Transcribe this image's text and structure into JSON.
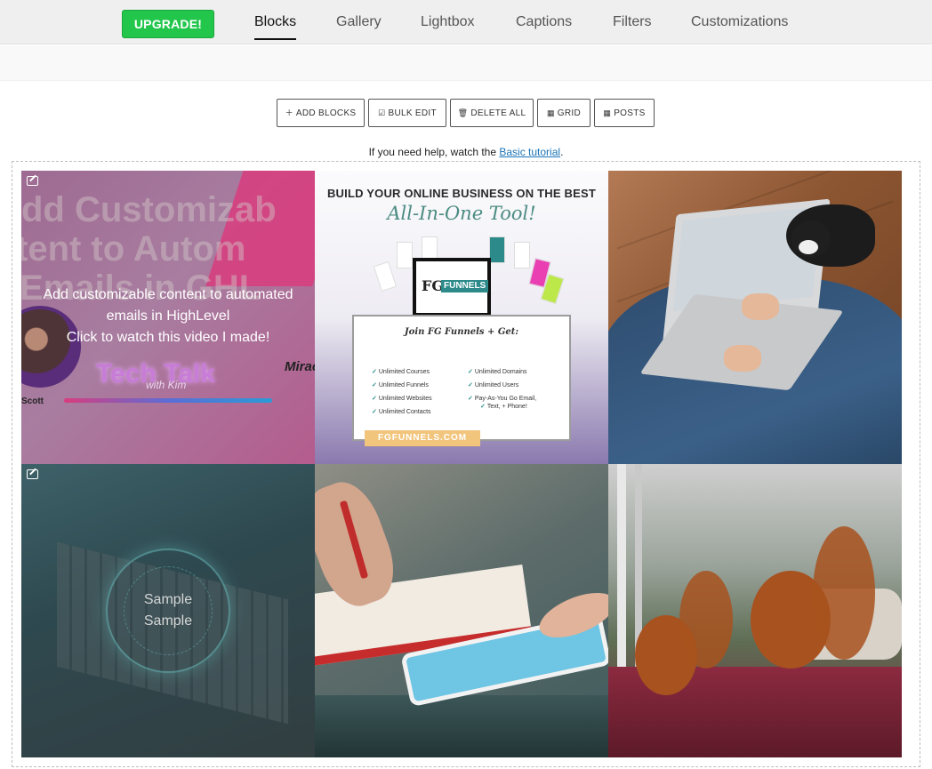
{
  "nav": {
    "upgrade_label": "UPGRADE!",
    "tabs": [
      {
        "label": "Blocks",
        "active": true
      },
      {
        "label": "Gallery",
        "active": false
      },
      {
        "label": "Lightbox",
        "active": false
      },
      {
        "label": "Captions",
        "active": false
      },
      {
        "label": "Filters",
        "active": false
      },
      {
        "label": "Customizations",
        "active": false
      }
    ]
  },
  "toolbar": {
    "add_blocks": {
      "icon": "plus-icon",
      "label": "ADD BLOCKS"
    },
    "bulk_edit": {
      "icon": "check-square-icon",
      "label": "BULK EDIT"
    },
    "delete_all": {
      "icon": "trash-icon",
      "label": "DELETE ALL"
    },
    "grid": {
      "icon": "grid-icon",
      "label": "GRID"
    },
    "posts": {
      "icon": "grid-icon",
      "label": "POSTS"
    }
  },
  "help": {
    "prefix": "If you need help, watch the ",
    "link_text": "Basic tutorial",
    "suffix": "."
  },
  "tiles": {
    "tile1": {
      "caption_line1": "Add customizable content to automated",
      "caption_line2": "emails in HighLevel",
      "caption_line3": "Click to watch this video I made!",
      "bg_line1": "dd Customizab",
      "bg_line2": "tent to Autom",
      "bg_line3": "Emails in GHL",
      "tech_talk": "Tech Talk",
      "with_kim": "with Kim",
      "name": "Scott",
      "script_name": "Mirac"
    },
    "tile2": {
      "headline": "BUILD YOUR ONLINE BUSINESS ON THE BEST",
      "subhead": "All-In-One Tool!",
      "logo_fg": "FG",
      "logo_funnels": "FUNNELS",
      "join": "Join FG Funnels + Get:",
      "features_left": [
        "Unlimited Courses",
        "Unlimited Funnels",
        "Unlimited Websites",
        "Unlimited Contacts"
      ],
      "features_right": [
        "Unlimited Domains",
        "Unlimited Users",
        "Pay-As-You Go Email,",
        "Text, + Phone!"
      ],
      "cta": "FGFUNNELS.COM"
    },
    "tile4": {
      "caption_line1": "Sample",
      "caption_line2": "Sample"
    }
  }
}
